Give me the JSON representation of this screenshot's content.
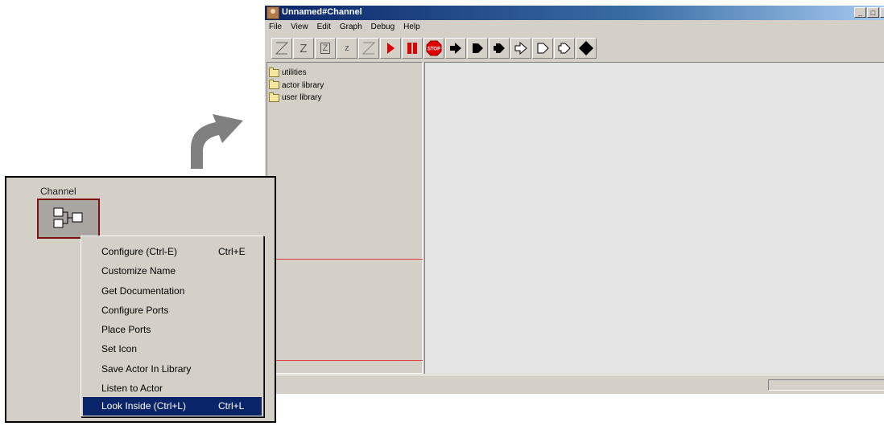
{
  "window": {
    "title": "Unnamed#Channel",
    "buttons": [
      "_",
      "□",
      "×"
    ]
  },
  "menubar": [
    "File",
    "View",
    "Edit",
    "Graph",
    "Debug",
    "Help"
  ],
  "toolbar": [
    {
      "name": "zoom-fit-icon",
      "glyph": ""
    },
    {
      "name": "zoom-reset-icon",
      "glyph": "Z"
    },
    {
      "name": "zoom-boxed-icon",
      "glyph": "Z"
    },
    {
      "name": "zoom-out-icon",
      "glyph": "z"
    },
    {
      "name": "zoom-diagonal-icon",
      "glyph": ""
    },
    {
      "name": "run-icon",
      "glyph": ""
    },
    {
      "name": "pause-icon",
      "glyph": ""
    },
    {
      "name": "stop-icon",
      "glyph": "STOP"
    },
    {
      "name": "add-input-port-icon",
      "glyph": ""
    },
    {
      "name": "add-output-port-icon",
      "glyph": ""
    },
    {
      "name": "add-io-port-icon",
      "glyph": ""
    },
    {
      "name": "add-multiport-input-icon",
      "glyph": ""
    },
    {
      "name": "add-multiport-output-icon",
      "glyph": ""
    },
    {
      "name": "add-multiport-io-icon",
      "glyph": ""
    },
    {
      "name": "add-relation-icon",
      "glyph": ""
    }
  ],
  "tree": {
    "items": [
      "utilities",
      "actor library",
      "user library"
    ]
  },
  "inset": {
    "actor_label": "Channel",
    "context_menu": [
      {
        "label": "Configure (Ctrl-E)",
        "shortcut": "Ctrl+E",
        "selected": false
      },
      {
        "label": "Customize Name",
        "shortcut": "",
        "selected": false
      },
      {
        "label": "Get Documentation",
        "shortcut": "",
        "selected": false
      },
      {
        "label": "Configure Ports",
        "shortcut": "",
        "selected": false
      },
      {
        "label": "Place Ports",
        "shortcut": "",
        "selected": false
      },
      {
        "label": "Set Icon",
        "shortcut": "",
        "selected": false
      },
      {
        "label": "Save Actor In Library",
        "shortcut": "",
        "selected": false
      },
      {
        "label": "Listen to Actor",
        "shortcut": "",
        "selected": false
      },
      {
        "label": "Look Inside (Ctrl+L)",
        "shortcut": "Ctrl+L",
        "selected": true
      }
    ]
  },
  "colors": {
    "titlebar": "#0a246a",
    "menu_selected": "#0a246a",
    "window_face": "#d4d0c8",
    "red_divider": "#e04040",
    "actor_border": "#7a1010"
  }
}
